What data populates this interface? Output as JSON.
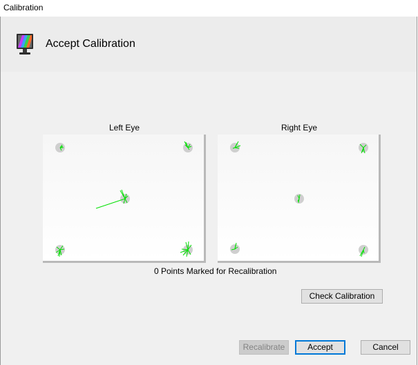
{
  "window": {
    "title": "Calibration"
  },
  "header": {
    "icon": "monitor-icon",
    "title": "Accept Calibration"
  },
  "left_eye": {
    "label": "Left Eye"
  },
  "right_eye": {
    "label": "Right Eye"
  },
  "status": {
    "points_marked": "0 Points Marked for Recalibration"
  },
  "buttons": {
    "check_calibration": "Check Calibration",
    "recalibrate": "Recalibrate",
    "accept": "Accept",
    "cancel": "Cancel"
  },
  "colors": {
    "gaze_samples": "#00e000",
    "target_points": "#cfcfcf",
    "accept_focus": "#0078d7",
    "client_background": "#f0f0f0"
  }
}
